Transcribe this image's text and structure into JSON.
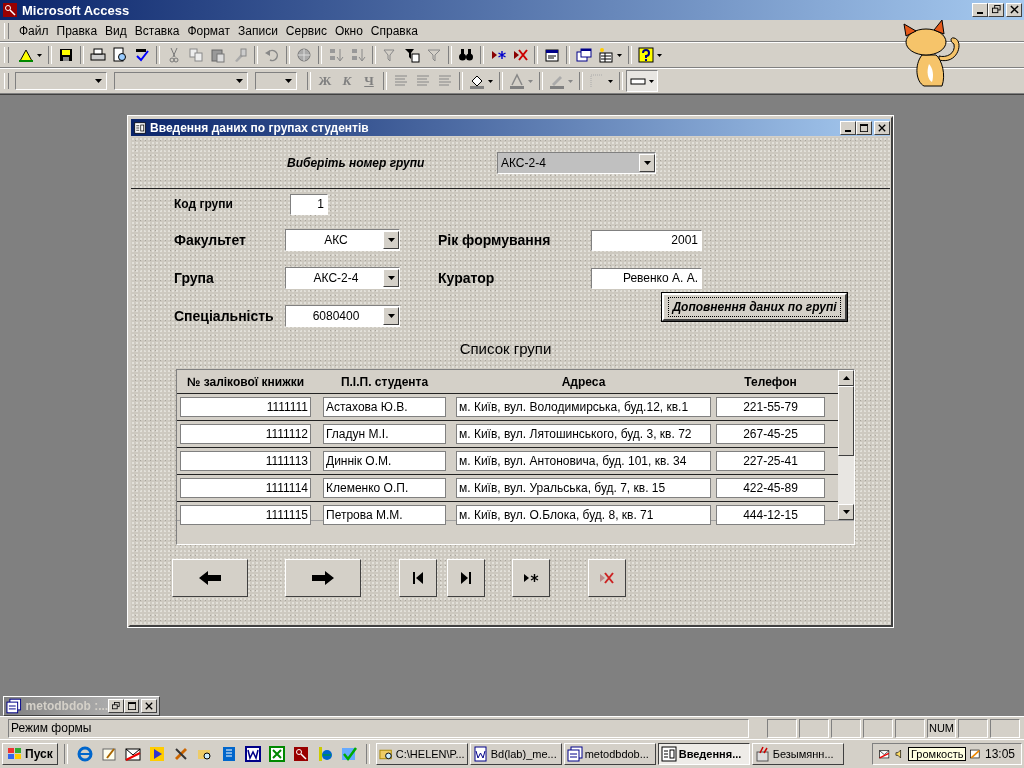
{
  "app": {
    "title": "Microsoft Access"
  },
  "menu": [
    "Файл",
    "Правка",
    "Вид",
    "Вставка",
    "Формат",
    "Записи",
    "Сервис",
    "Окно",
    "Справка"
  ],
  "format_buttons": [
    "Ж",
    "К",
    "Ч"
  ],
  "form": {
    "title": "Введення даних по групах студентів",
    "selector": {
      "label": "Виберіть номер групи",
      "value": "АКС-2-4"
    },
    "code": {
      "label": "Код групи",
      "value": "1"
    },
    "fields": [
      {
        "label": "Факультет",
        "value": "АКС",
        "kind": "combo"
      },
      {
        "label": "Рік формування",
        "value": "2001",
        "kind": "text"
      },
      {
        "label": "Група",
        "value": "АКС-2-4",
        "kind": "combo"
      },
      {
        "label": "Куратор",
        "value": "Ревенко А. А.",
        "kind": "text"
      },
      {
        "label": "Спеціальність",
        "value": "6080400",
        "kind": "combo"
      }
    ],
    "button": "Доповнення даних по групі",
    "subform": {
      "title": "Список групи",
      "columns": [
        "№ залікової книжки",
        "П.І.П. студента",
        "Адреса",
        "Телефон"
      ],
      "rows": [
        [
          "1111111",
          "Астахова Ю.В.",
          "м. Київ, вул. Володимирська, буд.12, кв.1",
          "221-55-79"
        ],
        [
          "1111112",
          "Гладун М.І.",
          "м. Київ, вул. Лятошинського, буд. 3, кв. 72",
          "267-45-25"
        ],
        [
          "1111113",
          "Диннік О.М.",
          "м. Київ, вул. Антоновича, буд. 101, кв. 34",
          "227-25-41"
        ],
        [
          "1111114",
          "Клеменко О.П.",
          "м. Київ, вул. Уральська, буд. 7, кв. 15",
          "422-45-89"
        ],
        [
          "1111115",
          "Петрова М.М.",
          "м. Київ, вул. О.Блока, буд. 8, кв. 71",
          "444-12-15"
        ]
      ]
    },
    "nav_buttons": [
      {
        "kind": "prev"
      },
      {
        "kind": "next"
      },
      {
        "kind": "first"
      },
      {
        "kind": "last"
      },
      {
        "kind": "new"
      },
      {
        "kind": "delete"
      }
    ]
  },
  "minimized": {
    "title": "metodbdob :..."
  },
  "status": {
    "text": "Режим формы",
    "num": "NUM"
  },
  "taskbar": {
    "start": "Пуск",
    "tasks": [
      {
        "label": "C:\\HELEN\\P...",
        "kind": "folder",
        "selected": false
      },
      {
        "label": "Bd(lab)_me...",
        "kind": "word",
        "selected": false
      },
      {
        "label": "metodbdob...",
        "kind": "database",
        "selected": false
      },
      {
        "label": "Введення...",
        "kind": "form",
        "selected": true
      },
      {
        "label": "Безымянн...",
        "kind": "paint",
        "selected": false
      }
    ],
    "tooltip": "Громкость",
    "clock": "13:05"
  }
}
